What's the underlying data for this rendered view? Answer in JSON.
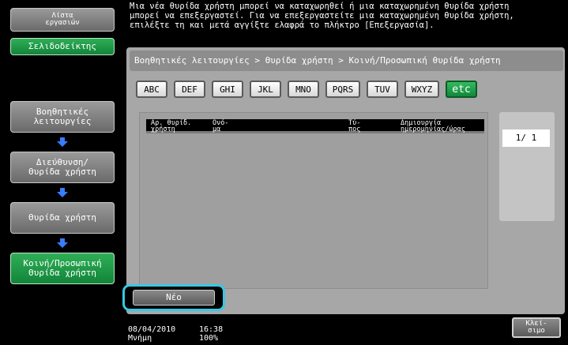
{
  "left_nav": {
    "job_list_button": "Λίστα\nεργασιών",
    "bookmark_button": "Σελιδοδείκτης",
    "path_items": [
      {
        "label": "Βοηθητικές\nλειτουργίες"
      },
      {
        "label": "Διεύθυνση/\nΘυρίδα χρήστη"
      },
      {
        "label": "Θυρίδα χρήστη"
      },
      {
        "label": "Κοινή/Προσωπική\nΘυρίδα χρήστη"
      }
    ]
  },
  "message": "Μια νέα θυρίδα χρήστη μπορεί να καταχωρηθεί ή μια καταχωρημένη θυρίδα χρήστη\nμπορεί να επεξεργαστεί. Για να επεξεργαστείτε μια καταχωρημένη θυρίδα χρήστη,\nεπιλέξτε τη και μετά αγγίξτε ελαφρά το πλήκτρο [Επεξεργασία].",
  "breadcrumb": "Βοηθητικές λειτουργίες > Θυρίδα χρήστη > Κοινή/Προσωπική θυρίδα χρήστη",
  "index_tabs": [
    "ABC",
    "DEF",
    "GHI",
    "JKL",
    "MNO",
    "PQRS",
    "TUV",
    "WXYZ",
    "etc"
  ],
  "active_tab": "etc",
  "list": {
    "columns": [
      "Αρ. θυρίδ.\nχρήστη",
      "Ονό-\nμα",
      "Τύ-\nπος",
      "Δημιουργία\nημερομηνίας/ώρας"
    ],
    "rows": []
  },
  "pager": {
    "page_label": "1/  1"
  },
  "buttons": {
    "new": "Νέο",
    "close": "Κλεί-\nσιμο"
  },
  "status": {
    "date": "08/04/2010",
    "time": "16:38",
    "memory_label": "Μνήμη",
    "memory_value": "100%"
  },
  "colors": {
    "accent_green": "#1a9a45",
    "highlight_ring": "#36c8e6",
    "panel_gray": "#a7a7a7"
  }
}
